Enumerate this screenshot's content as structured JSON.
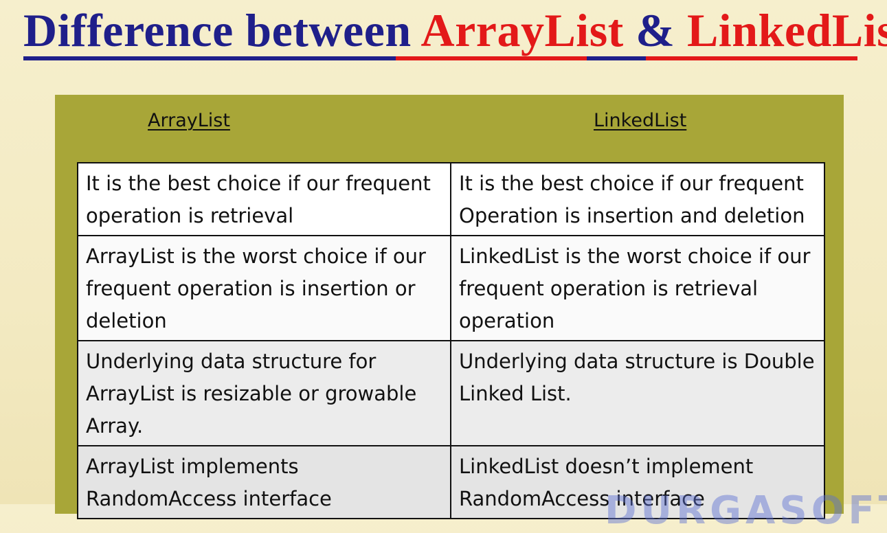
{
  "slide": {
    "title": {
      "part1": "Difference between ",
      "part2": "ArrayList",
      "part3": " & ",
      "part4": "LinkedList"
    },
    "colors": {
      "title_blue": "#1f1f8a",
      "title_red": "#e31919",
      "panel_olive": "#a8a638",
      "background": "#f6efcd"
    }
  },
  "comparison": {
    "headers": {
      "left": "ArrayList",
      "right": "LinkedList"
    },
    "rows": [
      {
        "arraylist": "It is the best choice if our frequent operation is retrieval",
        "linkedlist": "It is the best choice if our frequent Operation is insertion and deletion"
      },
      {
        "arraylist": "ArrayList is the worst choice if our frequent operation is insertion or deletion",
        "linkedlist": "LinkedList is the worst choice if our frequent operation is retrieval operation"
      },
      {
        "arraylist": "Underlying data structure for ArrayList is resizable or growable Array.",
        "linkedlist": "Underlying data structure is Double Linked List."
      },
      {
        "arraylist": "ArrayList implements RandomAccess interface",
        "linkedlist": "LinkedList doesn’t implement RandomAccess interface"
      }
    ]
  },
  "watermark": "DURGASOFT"
}
